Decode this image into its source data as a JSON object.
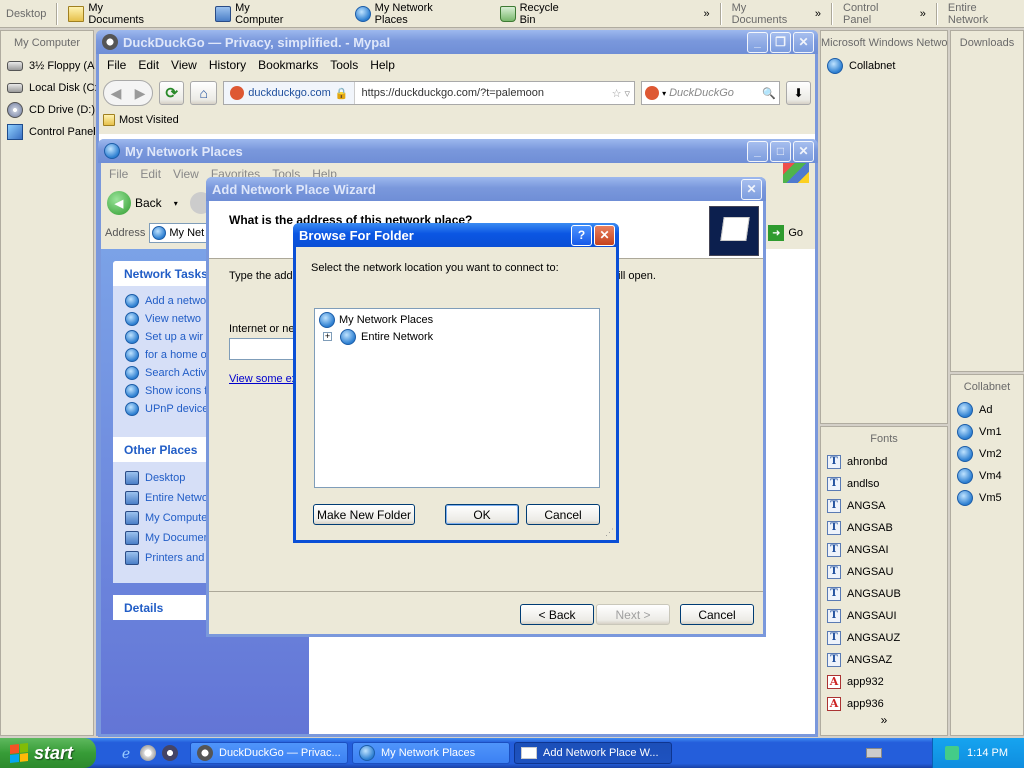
{
  "topbar": {
    "desktop": "Desktop",
    "my_documents": "My Documents",
    "my_computer": "My Computer",
    "my_network_places": "My Network Places",
    "recycle_bin": "Recycle Bin",
    "chevron": "»",
    "my_documents_2": "My Documents",
    "control_panel": "Control Panel",
    "entire_network": "Entire Network"
  },
  "left_panel": {
    "title": "My Computer",
    "items": [
      "3½ Floppy (A",
      "Local Disk (C:",
      "CD Drive (D:)",
      "Control Panel"
    ]
  },
  "right_panel_1": {
    "title": "Microsoft Windows Network",
    "items": [
      "Collabnet"
    ]
  },
  "right_panel_2": {
    "title": "Downloads"
  },
  "right_panel_3": {
    "title": "Collabnet",
    "items": [
      "Ad",
      "Vm1",
      "Vm2",
      "Vm4",
      "Vm5"
    ]
  },
  "fonts_panel": {
    "title": "Fonts",
    "items": [
      "ahronbd",
      "andlso",
      "ANGSA",
      "ANGSAB",
      "ANGSAI",
      "ANGSAU",
      "ANGSAUB",
      "ANGSAUI",
      "ANGSAUZ",
      "ANGSAZ",
      "app932",
      "app936"
    ],
    "more": "»"
  },
  "browser": {
    "title": "DuckDuckGo — Privacy, simplified. - Mypal",
    "menu": [
      "File",
      "Edit",
      "View",
      "History",
      "Bookmarks",
      "Tools",
      "Help"
    ],
    "site_id": "duckduckgo.com",
    "url": "https://duckduckgo.com/?t=palemoon",
    "search_placeholder": "DuckDuckGo",
    "bookmark": "Most Visited"
  },
  "explorer": {
    "title": "My Network Places",
    "menu": [
      "File",
      "Edit",
      "View",
      "Favorites",
      "Tools",
      "Help"
    ],
    "back": "Back",
    "address_label": "Address",
    "address_value": "My Net",
    "go": "Go",
    "network_tasks_title": "Network Tasks",
    "network_tasks": [
      "Add a netwo",
      "View netwo",
      "Set up a wir",
      "for a home o",
      "Search Activ",
      "Show icons f",
      "UPnP device"
    ],
    "other_places_title": "Other Places",
    "other_places": [
      "Desktop",
      "Entire Netwo",
      "My Compute",
      "My Documen",
      "Printers and"
    ],
    "details_title": "Details"
  },
  "wizard": {
    "title": "Add Network Place Wizard",
    "heading": "What is the address of this network place?",
    "instruction": "Type the add",
    "instruction_tail": "ill open.",
    "field_label": "Internet or ne",
    "link": "View some ex",
    "back": "< Back",
    "next": "Next >",
    "cancel": "Cancel"
  },
  "dialog": {
    "title": "Browse For Folder",
    "help": "?",
    "close": "✕",
    "prompt": "Select the network location you want to connect to:",
    "tree_root": "My Network Places",
    "tree_child": "Entire Network",
    "expander": "+",
    "make_new_folder": "Make New Folder",
    "ok": "OK",
    "cancel": "Cancel"
  },
  "taskbar": {
    "start": "start",
    "tasks": [
      "DuckDuckGo — Privac...",
      "My Network Places",
      "Add Network Place W..."
    ],
    "clock": "1:14 PM"
  },
  "colors": {
    "xp_blue": "#0a4fd6",
    "taskbar": "#245edb",
    "start_green": "#379c37",
    "tray": "#0f8ddf"
  }
}
